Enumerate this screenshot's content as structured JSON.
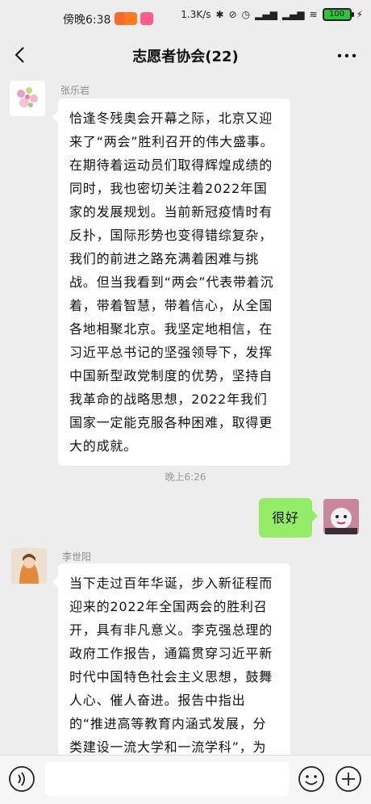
{
  "status_bar": {
    "time": "傍晚6:38",
    "network_speed": "1.3K/s",
    "battery": "100"
  },
  "header": {
    "title": "志愿者协会(22)"
  },
  "messages": [
    {
      "sender": "张乐岩",
      "text": "恰逢冬残奥会开幕之际，北京又迎来了“两会”胜利召开的伟大盛事。在期待着运动员们取得辉煌成绩的同时，我也密切关注着2022年国家的发展规划。当前新冠疫情时有反扑，国际形势也变得错综复杂，我们的前进之路充满着困难与挑战。但当我看到“两会”代表带着沉着，带着智慧，带着信心，从全国各地相聚北京。我坚定地相信，在习近平总书记的坚强领导下，发挥中国新型政党制度的优势，坚持自我革命的战略思想，2022年我们国家一定能克服各种困难，取得更大的成就。"
    },
    {
      "timestamp": "晚上6:26"
    },
    {
      "self": true,
      "text": "很好"
    },
    {
      "sender": "李世阳",
      "text": "当下走过百年华诞，步入新征程而迎来的2022年全国两会的胜利召开，具有非凡意义。李克强总理的政府工作报告，通篇贯穿习近平新时代中国特色社会主义思想，鼓舞人心、催人奋进。报告中指出的“推进高等教育内涵式发展，分类建设一流大学和一流学科”，为高等"
    }
  ],
  "input": {
    "placeholder": ""
  },
  "colors": {
    "self_bubble": "#95ec69",
    "background": "#ededed"
  }
}
